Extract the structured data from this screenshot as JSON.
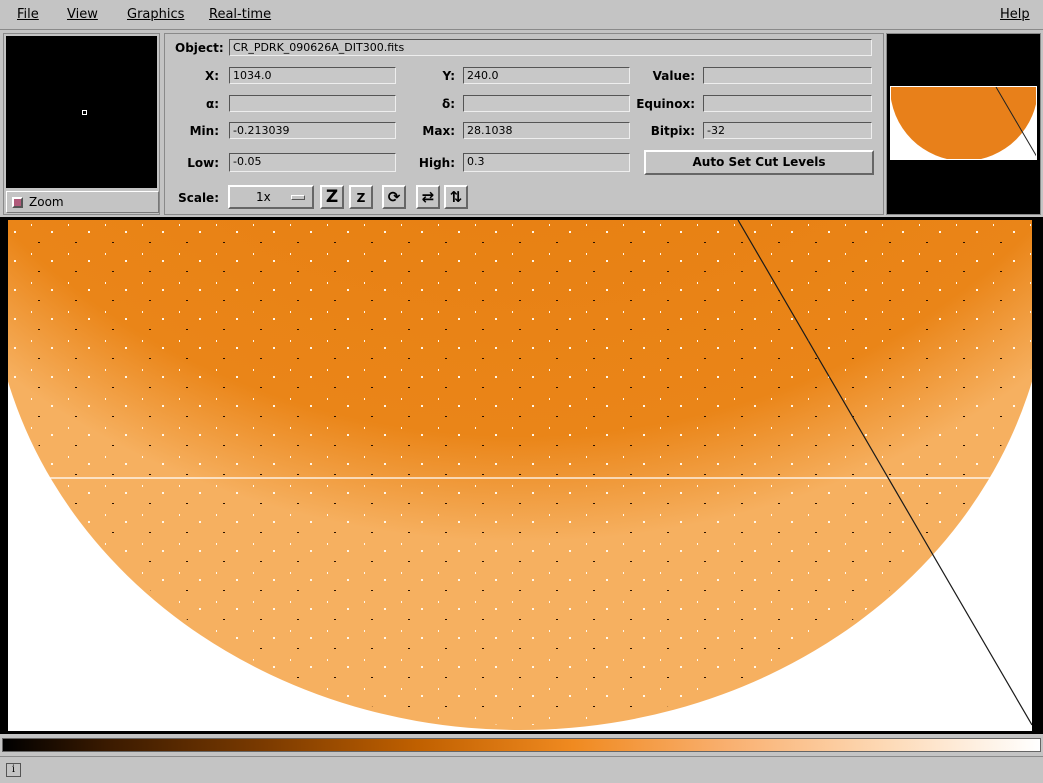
{
  "menu": {
    "file": "File",
    "view": "View",
    "graphics": "Graphics",
    "realtime": "Real-time",
    "help": "Help"
  },
  "zoom": {
    "label": "Zoom"
  },
  "info": {
    "object_label": "Object:",
    "object_value": "CR_PDRK_090626A_DIT300.fits",
    "x_label": "X:",
    "x_value": "1034.0",
    "y_label": "Y:",
    "y_value": "240.0",
    "value_label": "Value:",
    "value_value": "",
    "alpha_label": "α:",
    "alpha_value": "",
    "delta_label": "δ:",
    "delta_value": "",
    "equinox_label": "Equinox:",
    "equinox_value": "",
    "min_label": "Min:",
    "min_value": "-0.213039",
    "max_label": "Max:",
    "max_value": "28.1038",
    "bitpix_label": "Bitpix:",
    "bitpix_value": "-32",
    "low_label": "Low:",
    "low_value": "-0.05",
    "high_label": "High:",
    "high_value": "0.3",
    "autocut_label": "Auto Set Cut Levels",
    "scale_label": "Scale:",
    "scale_value": "1x"
  },
  "colors": {
    "image_orange": "#e07a10",
    "image_light": "#ffffff",
    "background": "#c4c4c4"
  },
  "icons": [
    "zoom-out-icon",
    "zoom-in-icon",
    "rotate-icon",
    "flip-x-icon",
    "flip-y-icon",
    "info-icon"
  ]
}
